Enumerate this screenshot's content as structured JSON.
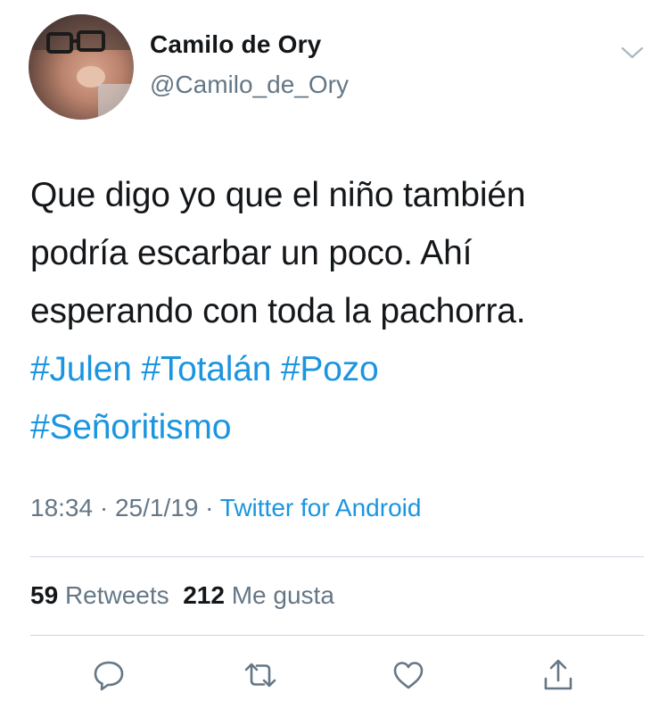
{
  "author": {
    "name": "Camilo de Ory",
    "handle": "@Camilo_de_Ory",
    "avatar_icon": "profile-photo"
  },
  "tweet": {
    "text_lines": [
      "Que digo yo que el niño también",
      "podría escarbar un poco. Ahí",
      "esperando con toda la pachorra."
    ],
    "hashtags": [
      "#Julen",
      "#Totalán",
      "#Pozo",
      "#Señoritismo"
    ]
  },
  "meta": {
    "time": "18:34",
    "separator": " · ",
    "date": "25/1/19",
    "source": "Twitter for Android"
  },
  "stats": {
    "retweets_count": "59",
    "retweets_label": "Retweets",
    "likes_count": "212",
    "likes_label": "Me gusta"
  },
  "icons": {
    "menu": "chevron-down-icon",
    "reply": "reply-icon",
    "retweet": "retweet-icon",
    "like": "heart-icon",
    "share": "share-icon"
  },
  "colors": {
    "link": "#1b95e0",
    "secondary_text": "#657786",
    "primary_text": "#14171a",
    "divider": "#ccd6dd"
  }
}
